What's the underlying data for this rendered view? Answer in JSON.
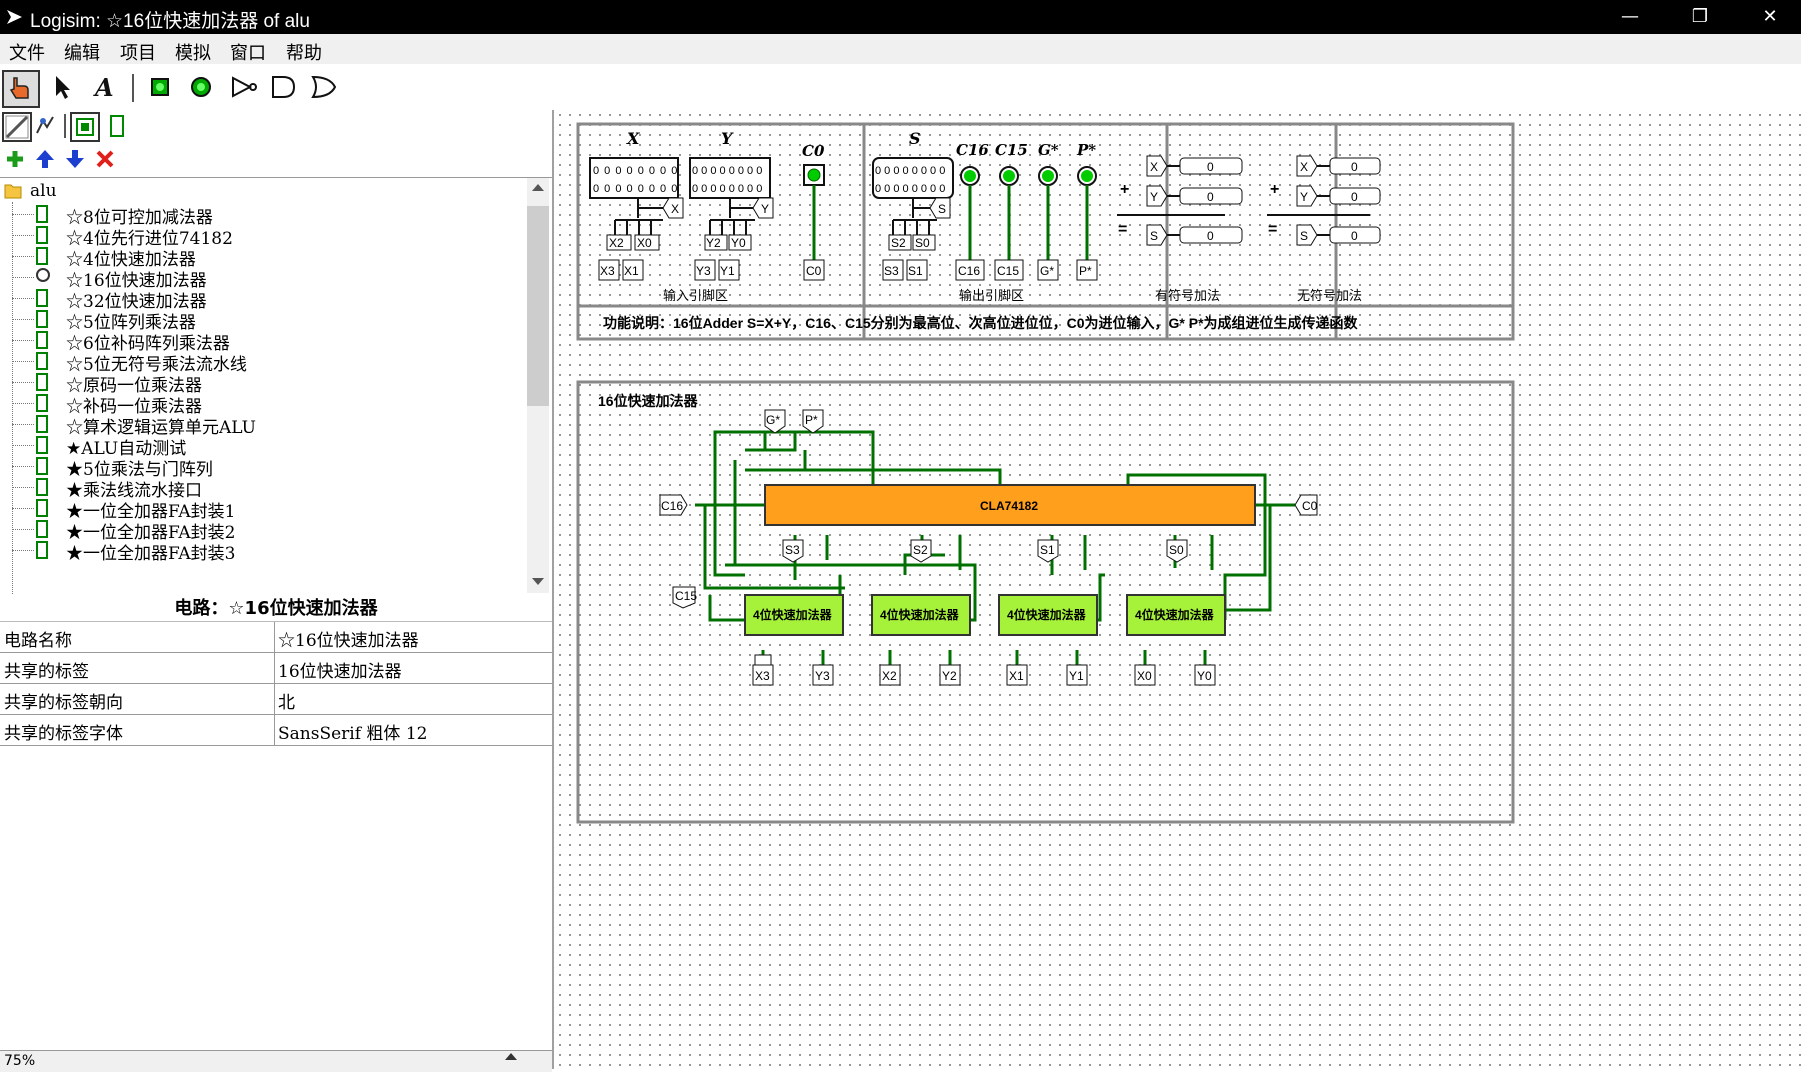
{
  "window": {
    "title": "Logisim: ☆16位快速加法器 of alu",
    "minimize": "—",
    "maximize": "❐",
    "close": "✕"
  },
  "menu": [
    "文件",
    "编辑",
    "项目",
    "模拟",
    "窗口",
    "帮助"
  ],
  "toolbar": {
    "tools": [
      "poke-tool",
      "select-tool",
      "text-tool",
      "input-pin",
      "output-pin",
      "not-gate",
      "and-gate",
      "or-gate"
    ],
    "explorer_tools": [
      "toggle-view",
      "edit-layout",
      "circuit-view",
      "appearance-view"
    ],
    "actions": [
      "add-circuit",
      "move-up",
      "move-down",
      "delete-circuit"
    ]
  },
  "tree": {
    "root": "alu",
    "items": [
      "☆8位可控加减法器",
      "☆4位先行进位74182",
      "☆4位快速加法器",
      "☆16位快速加法器",
      "☆32位快速加法器",
      "☆5位阵列乘法器",
      "☆6位补码阵列乘法器",
      "☆5位无符号乘法流水线",
      "☆原码一位乘法器",
      "☆补码一位乘法器",
      "☆算术逻辑运算单元ALU",
      "★ALU自动测试",
      "★5位乘法与门阵列",
      "★乘法线流水接口",
      "★一位全加器FA封装1",
      "★一位全加器FA封装2",
      "★一位全加器FA封装3"
    ],
    "active_index": 3
  },
  "properties": {
    "header": "电路：☆16位快速加法器",
    "rows": [
      {
        "key": "电路名称",
        "value": "☆16位快速加法器"
      },
      {
        "key": "共享的标签",
        "value": "16位快速加法器"
      },
      {
        "key": "共享的标签朝向",
        "value": "北"
      },
      {
        "key": "共享的标签字体",
        "value": "SansSerif 粗体 12"
      }
    ]
  },
  "zoom": "75%",
  "circuit": {
    "io_section": {
      "input_label": "输入引脚区",
      "output_label": "输出引脚区",
      "signed_label": "有符号加法",
      "unsigned_label": "无符号加法",
      "pins_in": [
        "X",
        "Y",
        "C0"
      ],
      "pins_out": [
        "S",
        "C16",
        "C15",
        "G*",
        "P*"
      ],
      "bits": "0 0 0 0 0 0 0 0",
      "in_tunnels_x": [
        "X3",
        "X1",
        "X2",
        "X0"
      ],
      "in_tunnels_y": [
        "Y3",
        "Y1",
        "Y2",
        "Y0"
      ],
      "out_tunnels_s": [
        "S3",
        "S1",
        "S2",
        "S0"
      ],
      "small_tunnels": {
        "x": "X",
        "y": "Y",
        "s": "S",
        "c0": "C0",
        "c16": "C16",
        "c15": "C15",
        "g": "G*",
        "p": "P*"
      },
      "ops": {
        "plus": "+",
        "eq": "="
      },
      "probe_value": "0"
    },
    "description": "功能说明：16位Adder S=X+Y，C16、C15分别为最高位、次高位进位位，C0为进位输入，G* P*为成组进位生成传递函数",
    "main_title": "16位快速加法器",
    "cla": "CLA74182",
    "adders": [
      "4位快速加法器",
      "4位快速加法器",
      "4位快速加法器",
      "4位快速加法器"
    ],
    "s_tunnels": [
      "S3",
      "S2",
      "S1",
      "S0"
    ],
    "x_tunnels": [
      "X3",
      "X2",
      "X1",
      "X0"
    ],
    "y_tunnels": [
      "Y3",
      "Y2",
      "Y1",
      "Y0"
    ],
    "tunnels": {
      "g": "G*",
      "p": "P*",
      "c16": "C16",
      "c0": "C0",
      "c15": "C15"
    }
  },
  "colors": {
    "wire": "#007000",
    "cla_fill": "#ff9f1c",
    "adder_fill": "#a6f23a",
    "frame": "#888888"
  }
}
